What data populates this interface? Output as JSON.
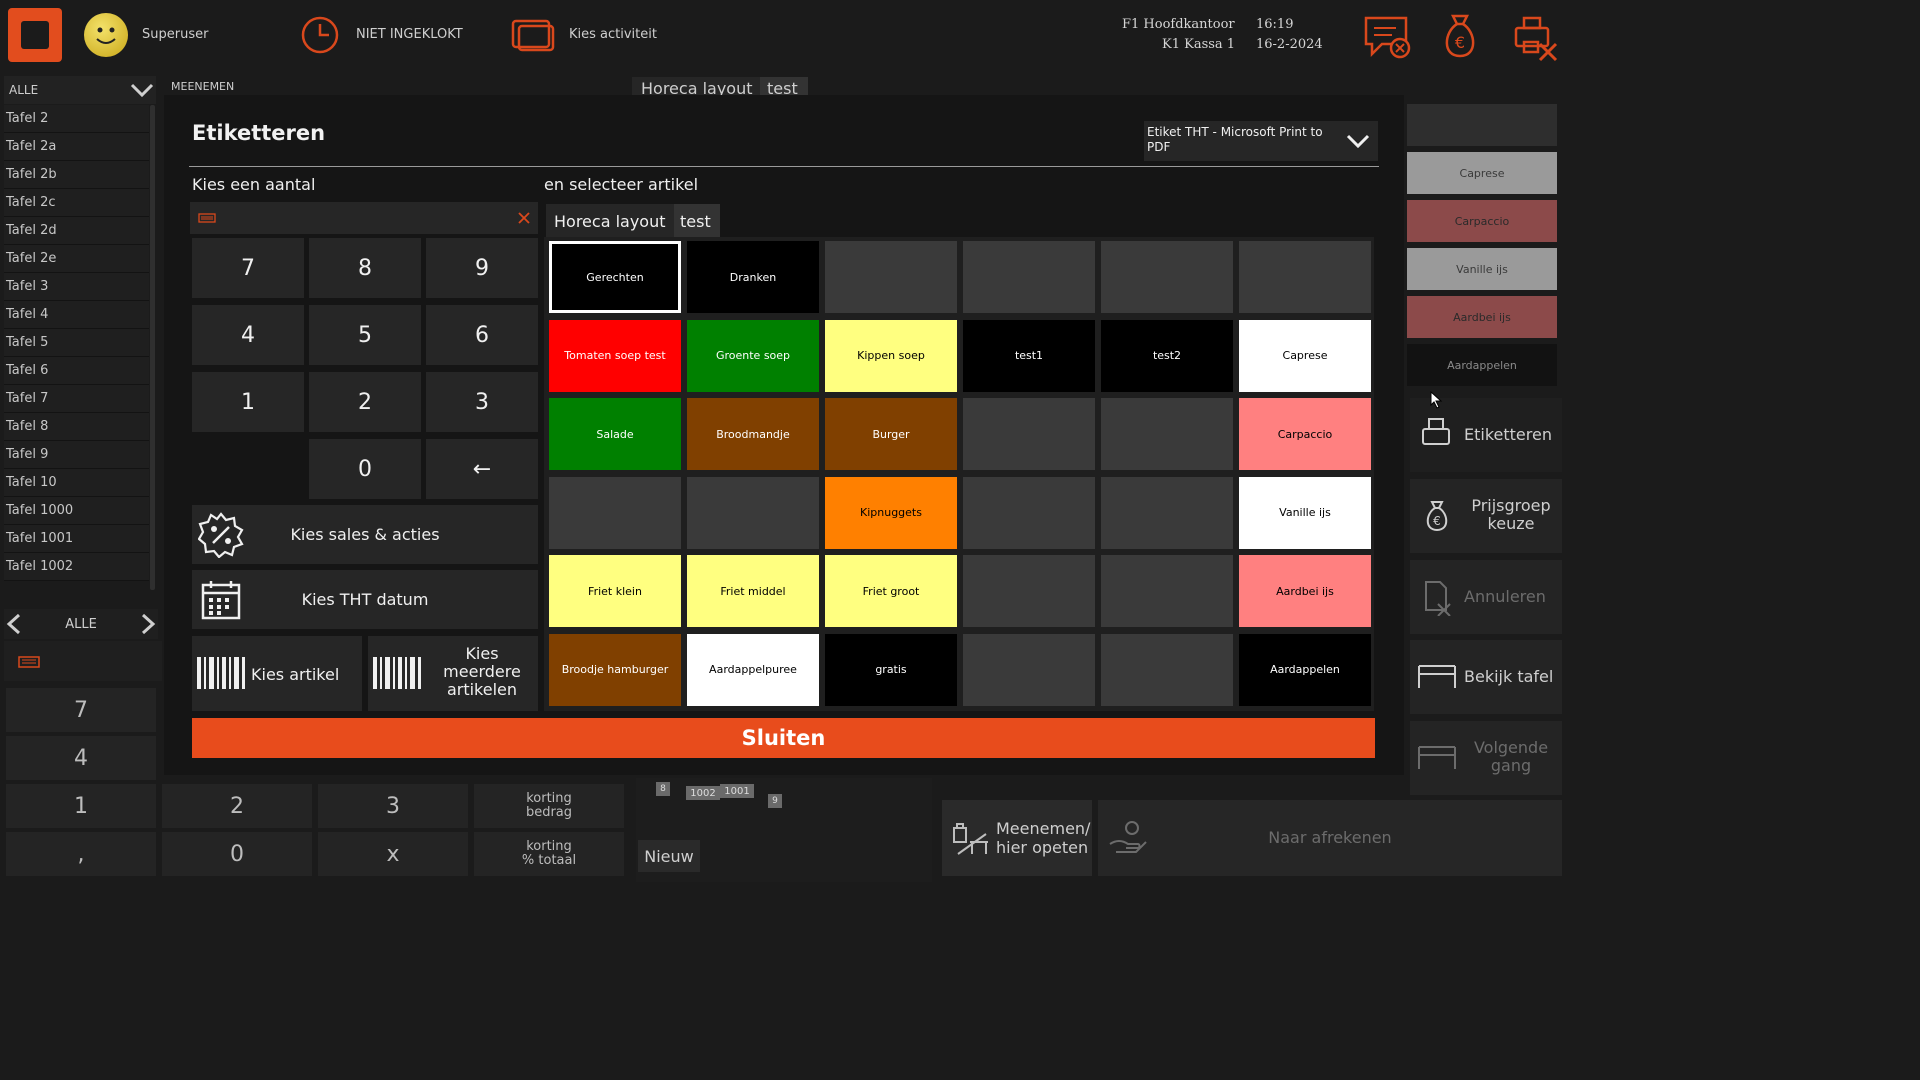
{
  "topbar": {
    "user": "Superuser",
    "clock_status": "NIET INGEKLOKT",
    "activity": "Kies activiteit",
    "location_line1": "F1 Hoofdkantoor",
    "location_line2": "K1 Kassa 1",
    "time": "16:19",
    "date": "16-2-2024"
  },
  "left": {
    "filter": "ALLE",
    "tables": [
      "Tafel 2",
      "Tafel 2a",
      "Tafel 2b",
      "Tafel 2c",
      "Tafel 2d",
      "Tafel 2e",
      "Tafel 3",
      "Tafel 4",
      "Tafel 5",
      "Tafel 6",
      "Tafel 7",
      "Tafel 8",
      "Tafel 9",
      "Tafel 10",
      "Tafel 1000",
      "Tafel 1001",
      "Tafel 1002"
    ],
    "pager_label": "ALLE"
  },
  "bg": {
    "takeaway_label": "MEENEMEN",
    "layout_tab": "Horeca layout",
    "layout_tab2": "test",
    "numpad": [
      "7",
      "4",
      "1",
      ","
    ],
    "numpad2": [
      "2",
      "3",
      "0",
      "x"
    ],
    "discount_amount": "korting\nbedrag",
    "discount_pct": "korting\n% totaal",
    "new_label": "Nieuw",
    "small_tables": [
      "8",
      "1002",
      "1001",
      "9"
    ],
    "takeaway_btn": "Meenemen/\nhier opeten",
    "checkout_btn": "Naar afrekenen"
  },
  "modal": {
    "title": "Etiketteren",
    "printer": "Etiket THT - Microsoft Print to PDF",
    "choose_amount": "Kies een aantal",
    "select_article": "en selecteer artikel",
    "keypad": [
      "7",
      "8",
      "9",
      "4",
      "5",
      "6",
      "1",
      "2",
      "3",
      "",
      "0",
      "←"
    ],
    "sales_actions": "Kies sales & acties",
    "tht_date": "Kies THT datum",
    "choose_article": "Kies artikel",
    "choose_multiple": "Kies\nmeerdere\nartikelen",
    "tab_layout": "Horeca layout",
    "tab_test": "test",
    "close": "Sluiten",
    "grid": [
      {
        "label": "Gerechten",
        "bg": "#000000",
        "fg": "#ffffff",
        "selected": true
      },
      {
        "label": "Dranken",
        "bg": "#000000",
        "fg": "#ffffff"
      },
      {
        "label": "",
        "bg": "#3a3a3a"
      },
      {
        "label": "",
        "bg": "#3a3a3a"
      },
      {
        "label": "",
        "bg": "#3a3a3a"
      },
      {
        "label": "",
        "bg": "#3a3a3a"
      },
      {
        "label": "Tomaten soep test",
        "bg": "#ff0000",
        "fg": "#ffffff"
      },
      {
        "label": "Groente soep",
        "bg": "#008000",
        "fg": "#ffffff"
      },
      {
        "label": "Kippen soep",
        "bg": "#ffff80",
        "fg": "#000000"
      },
      {
        "label": "test1",
        "bg": "#000000",
        "fg": "#ffffff"
      },
      {
        "label": "test2",
        "bg": "#000000",
        "fg": "#ffffff"
      },
      {
        "label": "Caprese",
        "bg": "#ffffff",
        "fg": "#000000"
      },
      {
        "label": "Salade",
        "bg": "#008000",
        "fg": "#ffffff"
      },
      {
        "label": "Broodmandje",
        "bg": "#804000",
        "fg": "#ffffff"
      },
      {
        "label": "Burger",
        "bg": "#804000",
        "fg": "#ffffff"
      },
      {
        "label": "",
        "bg": "#3a3a3a"
      },
      {
        "label": "",
        "bg": "#3a3a3a"
      },
      {
        "label": "Carpaccio",
        "bg": "#ff8080",
        "fg": "#000000"
      },
      {
        "label": "",
        "bg": "#3a3a3a"
      },
      {
        "label": "",
        "bg": "#3a3a3a"
      },
      {
        "label": "Kipnuggets",
        "bg": "#ff8000",
        "fg": "#000000"
      },
      {
        "label": "",
        "bg": "#3a3a3a"
      },
      {
        "label": "",
        "bg": "#3a3a3a"
      },
      {
        "label": "Vanille ijs",
        "bg": "#ffffff",
        "fg": "#000000"
      },
      {
        "label": "Friet klein",
        "bg": "#ffff80",
        "fg": "#000000"
      },
      {
        "label": "Friet middel",
        "bg": "#ffff80",
        "fg": "#000000"
      },
      {
        "label": "Friet groot",
        "bg": "#ffff80",
        "fg": "#000000"
      },
      {
        "label": "",
        "bg": "#3a3a3a"
      },
      {
        "label": "",
        "bg": "#3a3a3a"
      },
      {
        "label": "Aardbei ijs",
        "bg": "#ff8080",
        "fg": "#000000"
      },
      {
        "label": "Broodje hamburger",
        "bg": "#804000",
        "fg": "#ffffff"
      },
      {
        "label": "Aardappelpuree",
        "bg": "#ffffff",
        "fg": "#000000"
      },
      {
        "label": "gratis",
        "bg": "#000000",
        "fg": "#ffffff"
      },
      {
        "label": "",
        "bg": "#3a3a3a"
      },
      {
        "label": "",
        "bg": "#3a3a3a"
      },
      {
        "label": "Aardappelen",
        "bg": "#000000",
        "fg": "#ffffff"
      }
    ]
  },
  "right": {
    "items": [
      {
        "label": "",
        "bg": "#2e2e2e",
        "fg": "#888888"
      },
      {
        "label": "Caprese",
        "bg": "#9a9a9a",
        "fg": "#3a3a3a"
      },
      {
        "label": "Carpaccio",
        "bg": "#8c4a4a",
        "fg": "#2a2a2a"
      },
      {
        "label": "Vanille ijs",
        "bg": "#9a9a9a",
        "fg": "#3a3a3a"
      },
      {
        "label": "Aardbei ijs",
        "bg": "#8c4a4a",
        "fg": "#2a2a2a"
      },
      {
        "label": "Aardappelen",
        "bg": "#121212",
        "fg": "#8a8a8a"
      }
    ],
    "label_btn": "Etiketteren",
    "price_group": "Prijsgroep\nkeuze",
    "cancel": "Annuleren",
    "view_table": "Bekijk tafel",
    "next_course": "Volgende\ngang"
  },
  "colors": {
    "accent": "#e84c1c",
    "modal_bg": "#151515"
  }
}
